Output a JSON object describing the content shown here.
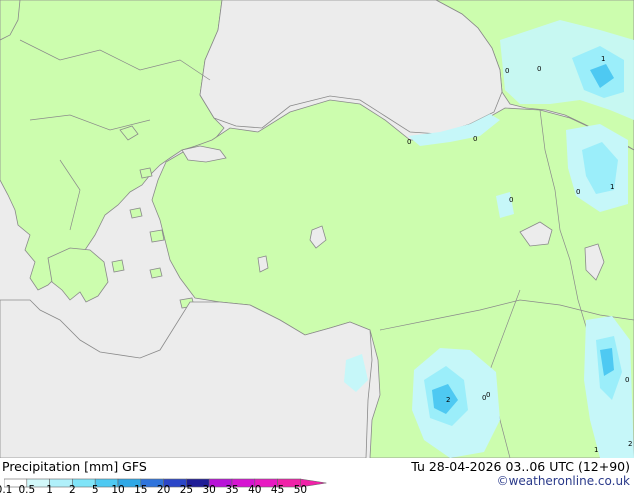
{
  "map": {
    "colors": {
      "sea": "#ececec",
      "land": "#ccfdae",
      "coast": "#8a8a8a",
      "precip_light": "#c6f7f9",
      "precip_mid": "#9beefa",
      "precip_high": "#4ec9f2"
    },
    "labels": [
      "0",
      "1",
      "0",
      "0",
      "0",
      "1",
      "0",
      "2",
      "0",
      "0",
      "1",
      "0",
      "0",
      "2"
    ]
  },
  "footer": {
    "title": "Precipitation [mm]  GFS",
    "datetime": "Tu 28-04-2026 03..06 UTC (12+90)",
    "credit": "©weatheronline.co.uk"
  },
  "scale": {
    "ticks": [
      "0.1",
      "0.5",
      "1",
      "2",
      "5",
      "10",
      "15",
      "20",
      "25",
      "30",
      "35",
      "40",
      "45",
      "50"
    ],
    "colors": [
      "#ffffff",
      "#d2f8fa",
      "#b0f0fa",
      "#7fe4f8",
      "#4ec9f2",
      "#2fa8e6",
      "#2f74dc",
      "#2b46c8",
      "#1e1c96",
      "#b812d8",
      "#d614d2",
      "#e81ac2",
      "#f022a8"
    ]
  }
}
